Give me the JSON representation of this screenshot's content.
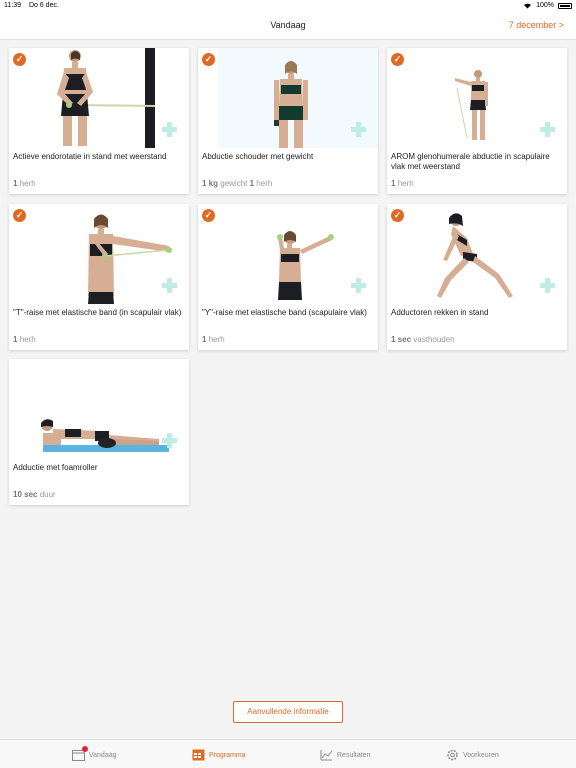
{
  "status": {
    "time": "11:39",
    "date": "Do 6 dec.",
    "battery": "100%"
  },
  "nav": {
    "title": "Vandaag",
    "date_link": "7 december >"
  },
  "exercises": [
    {
      "title": "Actieve endorotatie in stand met weerstand",
      "meta_value": "1",
      "meta_unit": "herh",
      "meta_value2": "",
      "meta_unit2": "",
      "completed": true
    },
    {
      "title": "Abductie schouder met gewicht",
      "meta_value": "1 kg",
      "meta_unit": "gewicht",
      "meta_value2": "1",
      "meta_unit2": "herh",
      "completed": true
    },
    {
      "title": "AROM glenohumerale abductie in scapulaire vlak met weerstand",
      "meta_value": "1",
      "meta_unit": "herh",
      "meta_value2": "",
      "meta_unit2": "",
      "completed": true
    },
    {
      "title": "\"T\"-raise met elastische band (in scapulair vlak)",
      "meta_value": "1",
      "meta_unit": "herh",
      "meta_value2": "",
      "meta_unit2": "",
      "completed": true
    },
    {
      "title": "\"Y\"-raise met elastische band (scapulaire vlak)",
      "meta_value": "1",
      "meta_unit": "herh",
      "meta_value2": "",
      "meta_unit2": "",
      "completed": true
    },
    {
      "title": "Adductoren rekken in stand",
      "meta_value": "1 sec",
      "meta_unit": "vasthouden",
      "meta_value2": "",
      "meta_unit2": "",
      "completed": true
    },
    {
      "title": "Adductie met foamroller",
      "meta_value": "10 sec",
      "meta_unit": "duur",
      "meta_value2": "",
      "meta_unit2": "",
      "completed": false
    }
  ],
  "info_button": "Aanvullende informatie",
  "tabs": [
    {
      "label": "Vandaag",
      "icon": "calendar-icon"
    },
    {
      "label": "Programma",
      "icon": "program-icon"
    },
    {
      "label": "Resultaten",
      "icon": "chart-icon"
    },
    {
      "label": "Voorkeuren",
      "icon": "gear-icon"
    }
  ],
  "colors": {
    "accent": "#e06a24",
    "plus": "#bfece3",
    "badge": "#e8212e"
  }
}
